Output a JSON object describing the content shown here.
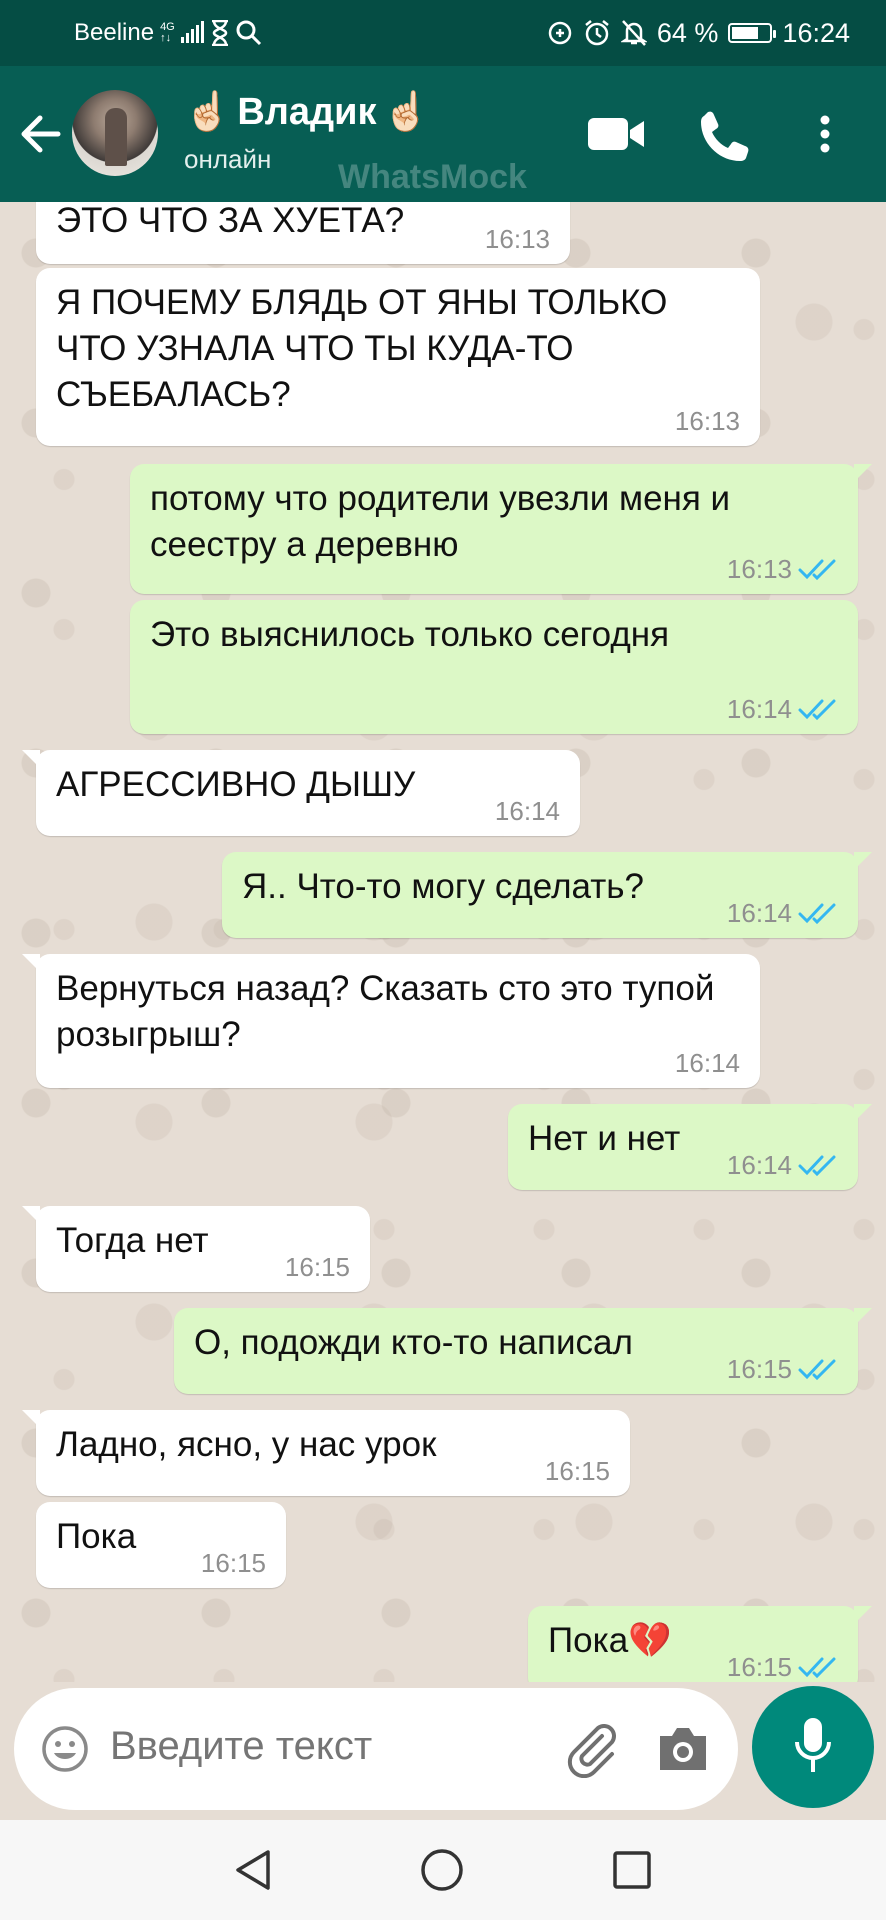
{
  "status_bar": {
    "carrier": "Beeline",
    "network_top": "4G",
    "network_bottom": "↑↓",
    "battery_percent": "64 %",
    "battery_level": 0.64,
    "time": "16:24"
  },
  "header": {
    "contact_name": "Владик",
    "emoji": "☝🏻",
    "status": "онлайн",
    "watermark": "WhatsMock",
    "icons": [
      "back-arrow-icon",
      "video-call-icon",
      "voice-call-icon",
      "more-vert-icon"
    ]
  },
  "messages": [
    {
      "dir": "in",
      "text": "ЭТО ЧТО ЗА ХУЕТА?",
      "time": "16:13"
    },
    {
      "dir": "in",
      "text": "Я ПОЧЕМУ БЛЯДЬ ОТ ЯНЫ ТОЛЬКО ЧТО УЗНАЛА ЧТО ТЫ КУДА-ТО СЪЕБАЛАСЬ?",
      "time": "16:13"
    },
    {
      "dir": "out",
      "text": "потому что родители увезли меня и сеестру а деревню",
      "time": "16:13",
      "read": true
    },
    {
      "dir": "out",
      "text": "Это выяснилось только сегодня",
      "time": "16:14",
      "read": true
    },
    {
      "dir": "in",
      "text": "АГРЕССИВНО ДЫШУ",
      "time": "16:14"
    },
    {
      "dir": "out",
      "text": "Я.. Что-то могу сделать?",
      "time": "16:14",
      "read": true
    },
    {
      "dir": "in",
      "text": "Вернуться назад? Сказать сто это тупой розыгрыш?",
      "time": "16:14"
    },
    {
      "dir": "out",
      "text": "Нет и нет",
      "time": "16:14",
      "read": true
    },
    {
      "dir": "in",
      "text": "Тогда нет",
      "time": "16:15"
    },
    {
      "dir": "out",
      "text": "О, подожди кто-то написал",
      "time": "16:15",
      "read": true
    },
    {
      "dir": "in",
      "text": "Ладно, ясно, у нас урок",
      "time": "16:15"
    },
    {
      "dir": "in",
      "text": "Пока",
      "time": "16:15"
    },
    {
      "dir": "out",
      "text": "Пока💔",
      "time": "16:15",
      "read": true
    }
  ],
  "input": {
    "placeholder": "Введите текст",
    "icons": [
      "emoji-icon",
      "attach-icon",
      "camera-icon",
      "mic-icon"
    ]
  },
  "navbar": {
    "icons": [
      "nav-back-icon",
      "nav-home-icon",
      "nav-recents-icon"
    ]
  },
  "colors": {
    "status_bar": "#054d44",
    "header": "#075e54",
    "outgoing_bubble": "#dcf8c6",
    "incoming_bubble": "#ffffff",
    "read_ticks": "#34b7f1",
    "mic_button": "#00897b"
  }
}
